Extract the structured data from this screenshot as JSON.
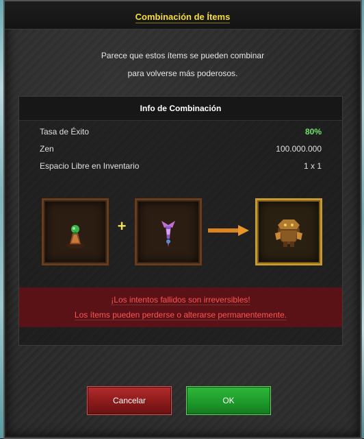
{
  "dialog": {
    "title": "Combinación de Ítems",
    "intro_line1": "Parece que estos ítems se pueden combinar",
    "intro_line2": "para volverse más poderosos."
  },
  "info": {
    "header": "Info de Combinación",
    "rows": [
      {
        "label": "Tasa de Éxito",
        "value": "80%"
      },
      {
        "label": "Zen",
        "value": "100.000.000"
      },
      {
        "label": "Espacio Libre en Inventario",
        "value": "1 x 1"
      }
    ]
  },
  "combination": {
    "plus_symbol": "+",
    "ingredients": [
      {
        "icon": "green-figurine-item-icon"
      },
      {
        "icon": "purple-wing-item-icon"
      }
    ],
    "result": {
      "icon": "armored-creature-item-icon"
    }
  },
  "warning": {
    "line1": "¡Los intentos fallidos son irreversibles!",
    "line2": "Los ítems pueden perderse o alterarse permanentemente."
  },
  "buttons": {
    "cancel": "Cancelar",
    "ok": "OK"
  },
  "colors": {
    "title": "#f7df3a",
    "success_rate": "#6ee36a",
    "warning_text": "#ff5454",
    "warning_bg": "#5a1216",
    "cancel_btn": "#8b1a1a",
    "ok_btn": "#1e9a2a"
  }
}
